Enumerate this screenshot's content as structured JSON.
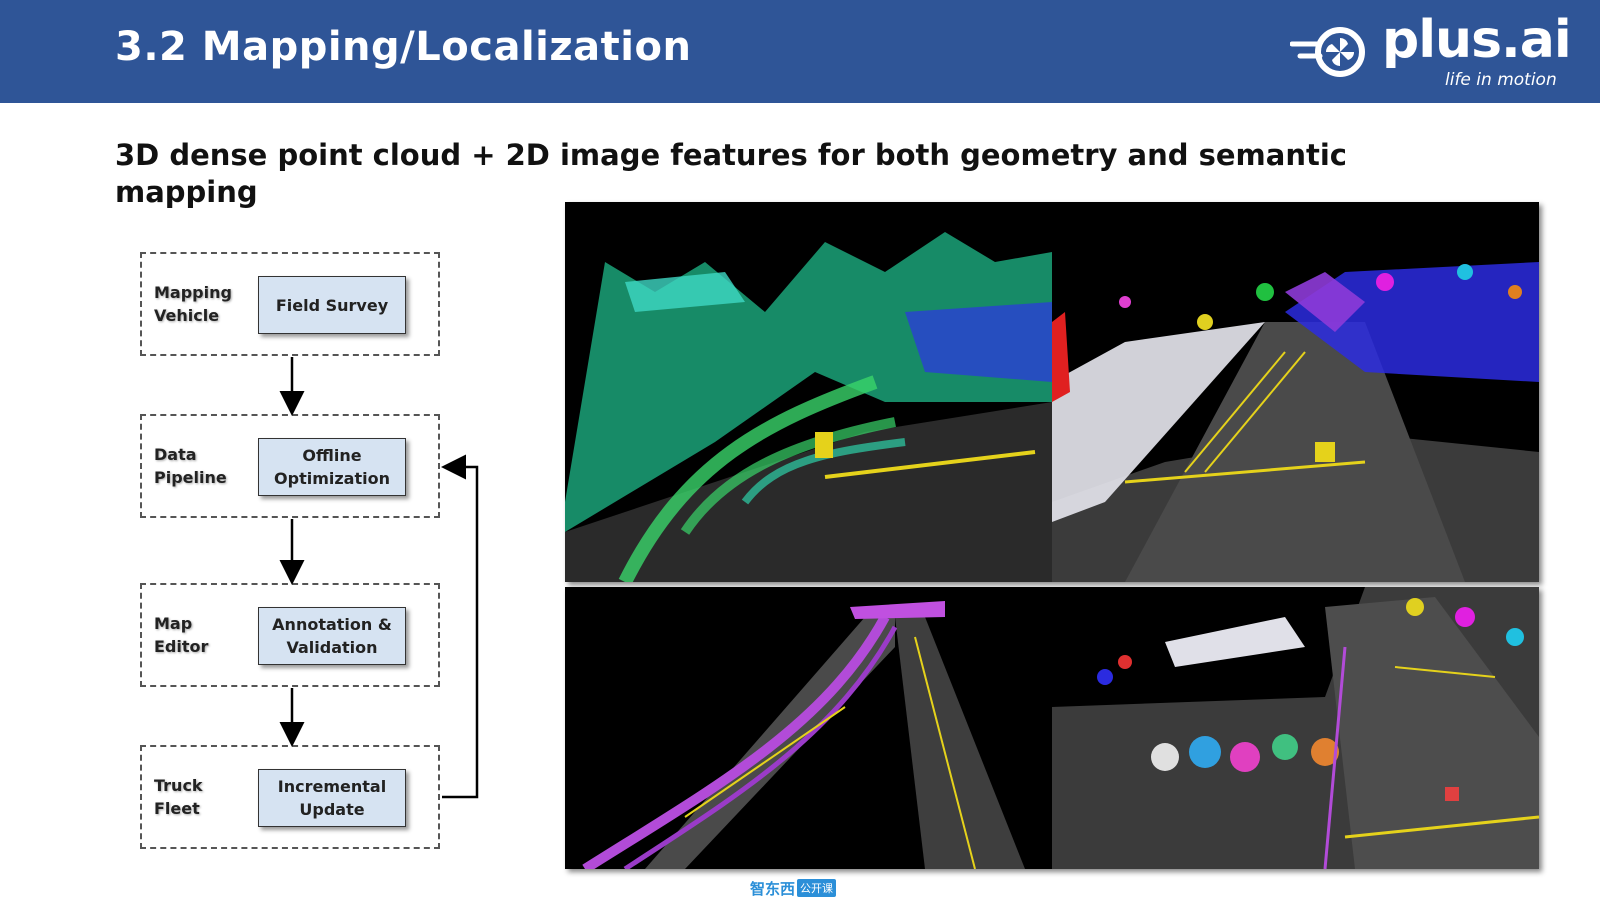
{
  "header": {
    "title": "3.2 Mapping/Localization",
    "logo": {
      "wordmark": "plus.ai",
      "tagline": "life in motion"
    },
    "color": "#2f5597"
  },
  "subtitle": "3D dense point cloud + 2D image features for both geometry and semantic mapping",
  "flow": {
    "stages": [
      {
        "label": "Mapping\nVehicle",
        "step": "Field Survey"
      },
      {
        "label": "Data\nPipeline",
        "step": "Offline\nOptimization"
      },
      {
        "label": "Map\nEditor",
        "step": "Annotation &\nValidation"
      },
      {
        "label": "Truck\nFleet",
        "step": "Incremental\nUpdate"
      }
    ],
    "feedback_loop": "Incremental Update → Offline Optimization"
  },
  "images": [
    {
      "name": "point-cloud-intensity",
      "palette": "cyan-green"
    },
    {
      "name": "point-cloud-semantic-road",
      "palette": "semantic"
    },
    {
      "name": "point-cloud-highway-ramp",
      "palette": "magenta-gray"
    },
    {
      "name": "point-cloud-intersection",
      "palette": "semantic"
    }
  ],
  "watermark": {
    "brand": "智东西",
    "tag": "公开课"
  }
}
